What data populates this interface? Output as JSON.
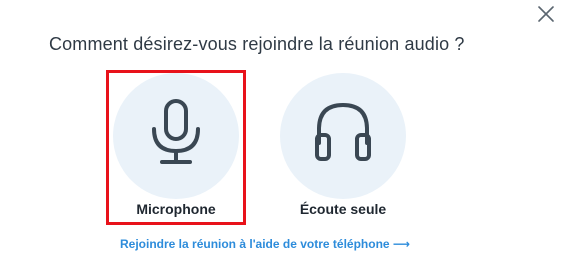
{
  "dialog": {
    "prompt": "Comment désirez-vous rejoindre la réunion audio ?",
    "options": [
      {
        "label": "Microphone",
        "icon": "microphone-icon",
        "selected": true
      },
      {
        "label": "Écoute seule",
        "icon": "headphones-icon",
        "selected": false
      }
    ],
    "phone_link": "Rejoindre la réunion à l'aide de votre téléphone ⟶",
    "close_icon": "close-icon"
  },
  "colors": {
    "selection_border": "#e8121a",
    "icon_circle": "#eaf2f9",
    "icon_stroke": "#3a4753",
    "link": "#2d8cdb"
  }
}
